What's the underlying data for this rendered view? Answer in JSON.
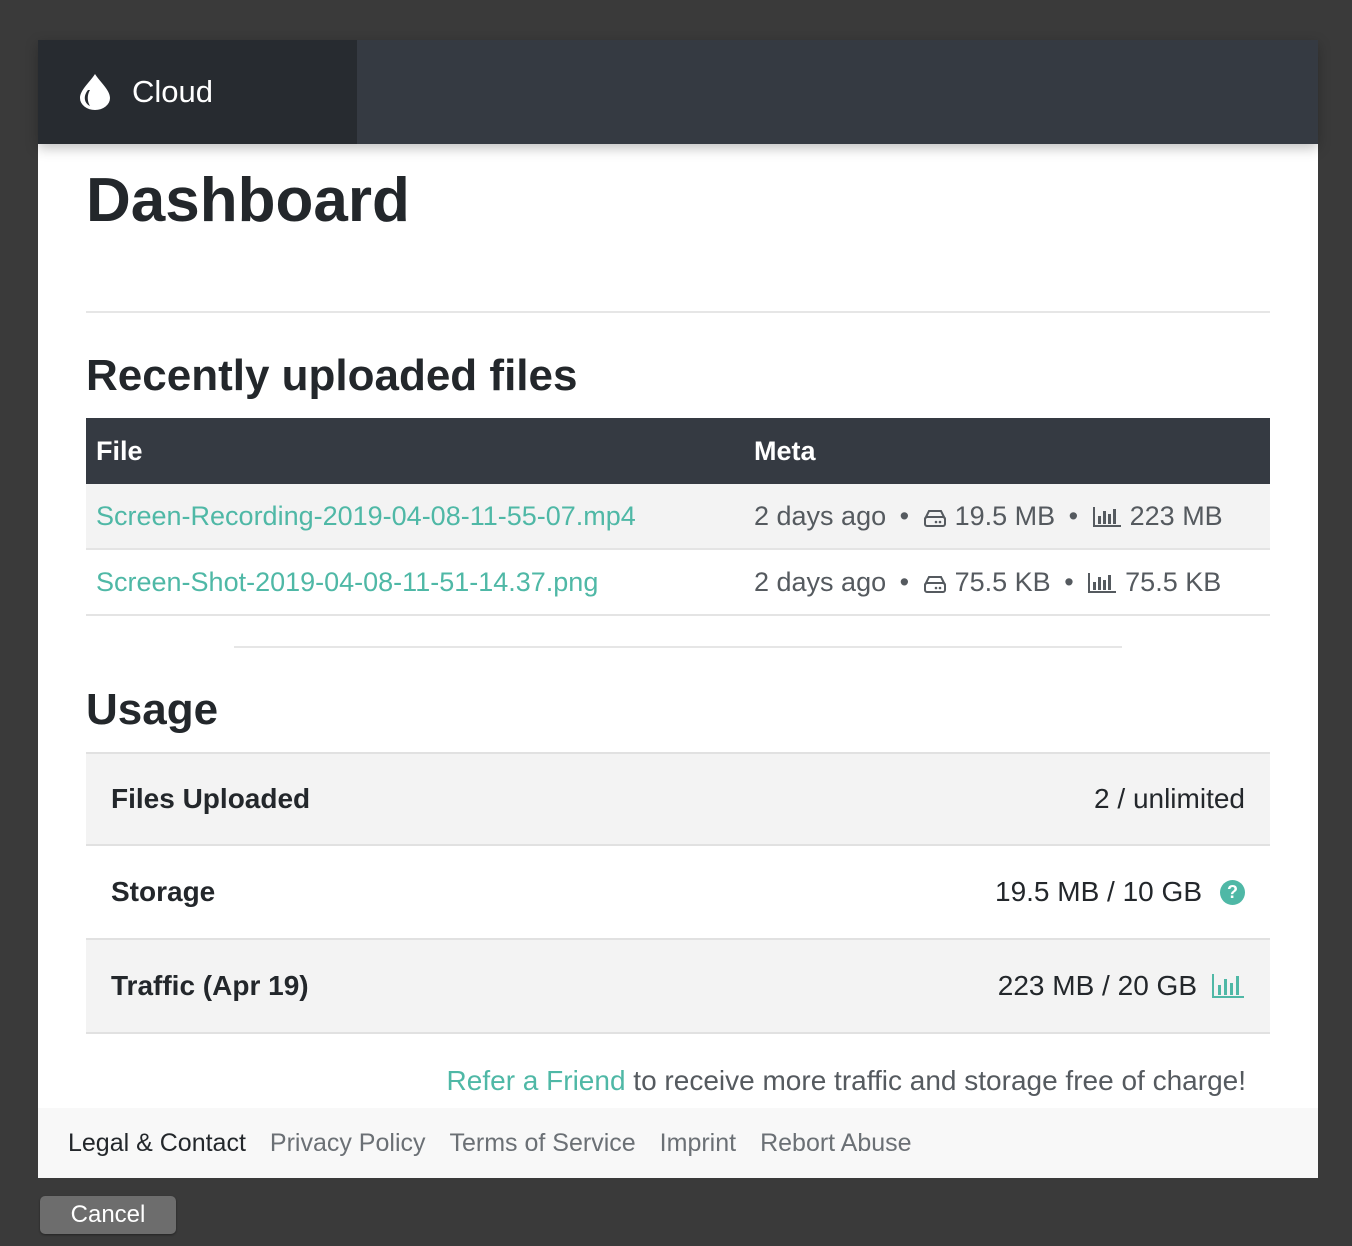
{
  "header": {
    "brand_name": "Cloud",
    "logo_icon": "droplet-icon"
  },
  "page": {
    "title": "Dashboard"
  },
  "files_section": {
    "title": "Recently uploaded files",
    "columns": [
      "File",
      "Meta"
    ],
    "rows": [
      {
        "name": "Screen-Recording-2019-04-08-11-55-07.mp4",
        "age": "2 days ago",
        "size": "19.5 MB",
        "traffic": "223 MB"
      },
      {
        "name": "Screen-Shot-2019-04-08-11-51-14.37.png",
        "age": "2 days ago",
        "size": "75.5 KB",
        "traffic": "75.5 KB"
      }
    ],
    "separator": "•",
    "size_icon": "hard-drive-icon",
    "traffic_icon": "bar-chart-icon"
  },
  "usage_section": {
    "title": "Usage",
    "files_uploaded": {
      "label": "Files Uploaded",
      "value": "2 / unlimited"
    },
    "storage": {
      "label": "Storage",
      "value": "19.5 MB / 10 GB",
      "icon": "question-circle-icon",
      "icon_glyph": "?"
    },
    "traffic": {
      "label": "Traffic (Apr 19)",
      "value": "223 MB / 20 GB",
      "icon": "bar-chart-icon"
    }
  },
  "refer": {
    "link": "Refer a Friend",
    "text": " to receive more traffic and storage free of charge!"
  },
  "footer": {
    "title": "Legal & Contact",
    "links": [
      "Privacy Policy",
      "Terms of Service",
      "Imprint",
      "Rebort Abuse"
    ]
  },
  "dialog": {
    "cancel_label": "Cancel"
  },
  "colors": {
    "accent": "#4fb8a6",
    "topbar": "#353a42",
    "brand_bg": "#272b30",
    "backdrop": "#3a3a3a"
  }
}
